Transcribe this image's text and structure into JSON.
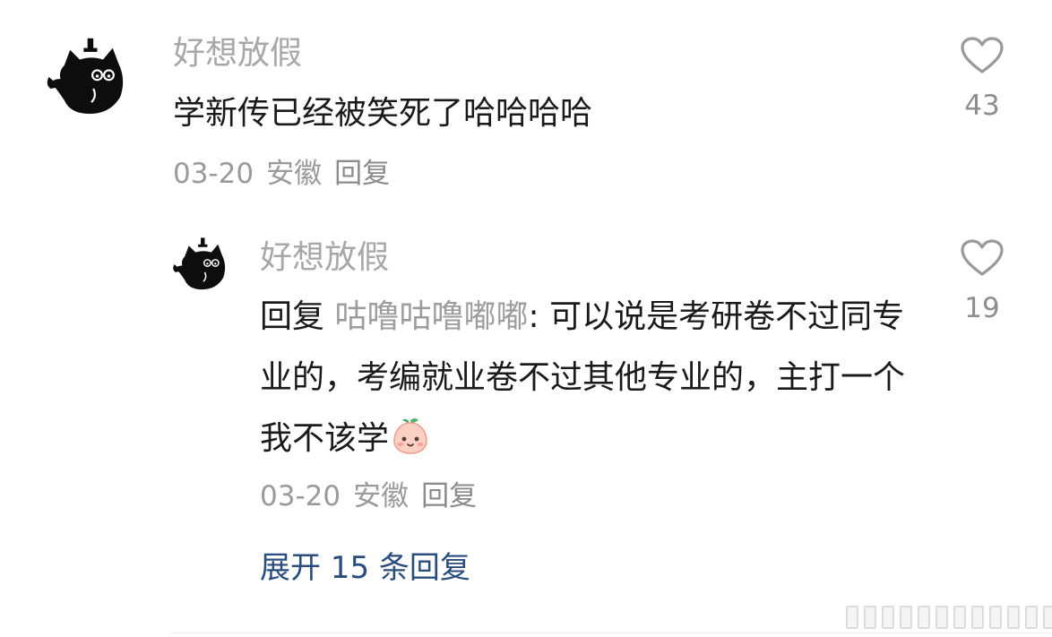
{
  "comment": {
    "username": "好想放假",
    "text": "学新传已经被笑死了哈哈哈哈",
    "date": "03-20",
    "location": "安徽",
    "reply_label": "回复",
    "like_count": "43",
    "avatar_icon": "black-cat-avatar",
    "like_icon": "heart-outline-icon"
  },
  "reply": {
    "username": "好想放假",
    "reply_prefix": "回复",
    "mention": "咕噜咕噜嘟嘟",
    "separator": ":",
    "text": "可以说是考研卷不过同专业的，考编就业卷不过其他专业的，主打一个我不该学",
    "emoji": "peach-face-emoji",
    "date": "03-20",
    "location": "安徽",
    "reply_label": "回复",
    "like_count": "19"
  },
  "expand": {
    "label": "展开 15 条回复"
  },
  "colors": {
    "username": "#a7a7a7",
    "body_text": "#1a1a1a",
    "meta_text": "#9a9a9a",
    "link_blue": "#2b4d7e",
    "heart_outline": "#9a9a9a"
  }
}
